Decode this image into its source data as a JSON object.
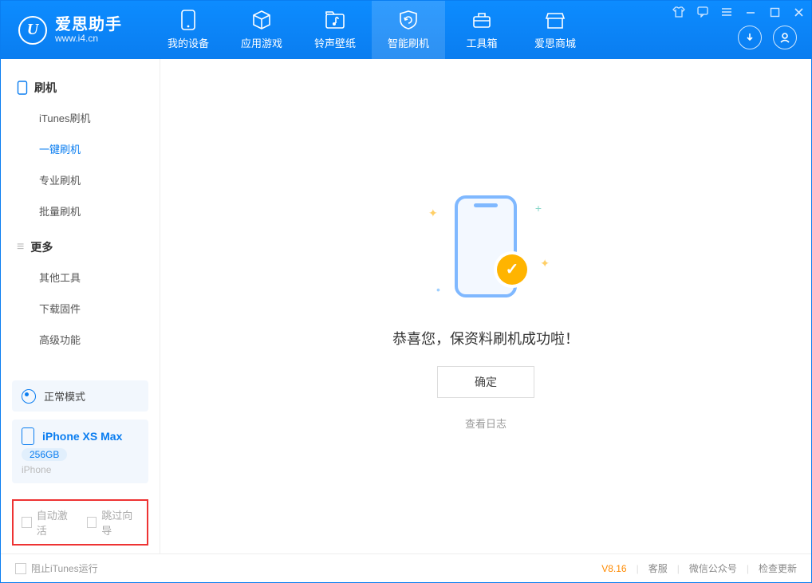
{
  "app": {
    "name_cn": "爱思助手",
    "name_en": "www.i4.cn",
    "logo_letter": "U"
  },
  "tabs": [
    {
      "label": "我的设备"
    },
    {
      "label": "应用游戏"
    },
    {
      "label": "铃声壁纸"
    },
    {
      "label": "智能刷机"
    },
    {
      "label": "工具箱"
    },
    {
      "label": "爱思商城"
    }
  ],
  "sidebar": {
    "group1_title": "刷机",
    "group1_items": [
      "iTunes刷机",
      "一键刷机",
      "专业刷机",
      "批量刷机"
    ],
    "group2_title": "更多",
    "group2_items": [
      "其他工具",
      "下载固件",
      "高级功能"
    ]
  },
  "mode_label": "正常模式",
  "device": {
    "name": "iPhone XS Max",
    "capacity": "256GB",
    "type": "iPhone"
  },
  "options": {
    "auto_activate": "自动激活",
    "skip_wizard": "跳过向导"
  },
  "main": {
    "message": "恭喜您，保资料刷机成功啦！",
    "ok": "确定",
    "view_log": "查看日志"
  },
  "status": {
    "block_itunes": "阻止iTunes运行",
    "version": "V8.16",
    "links": [
      "客服",
      "微信公众号",
      "检查更新"
    ]
  }
}
